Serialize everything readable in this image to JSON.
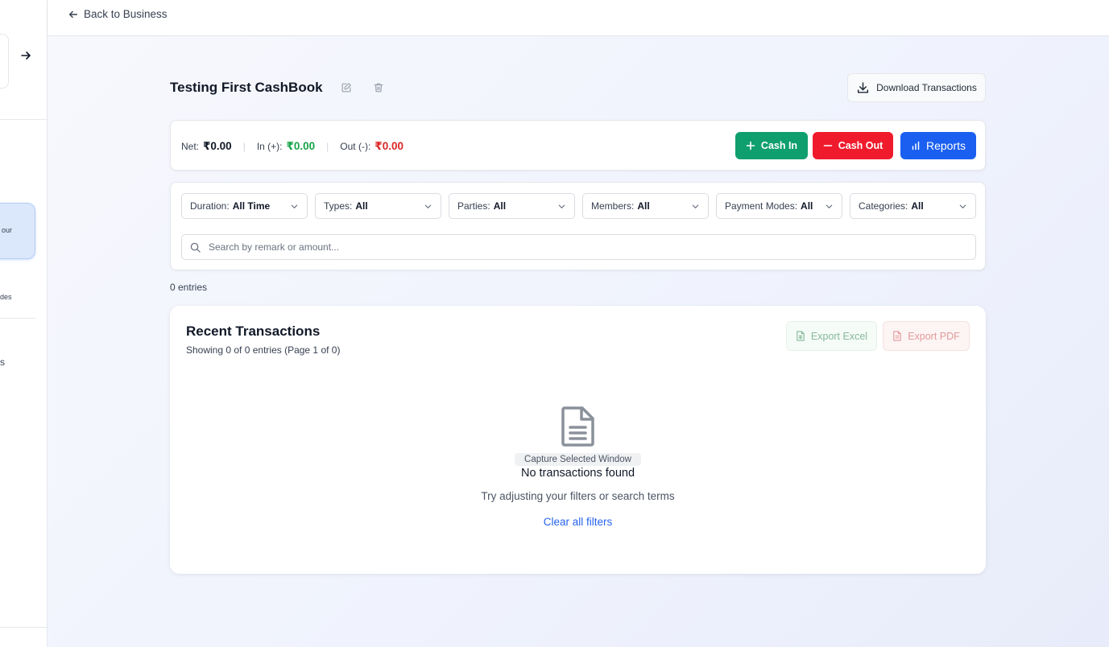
{
  "sidebar": {
    "active_item_label": "our",
    "item_label_2": "des",
    "item_label_3": "s"
  },
  "topbar": {
    "back_label": "Back to Business"
  },
  "header": {
    "title": "Testing First CashBook",
    "download_label": "Download Transactions"
  },
  "summary": {
    "net_label": "Net:",
    "net_value": "₹0.00",
    "in_label": "In (+):",
    "in_value": "₹0.00",
    "out_label": "Out (-):",
    "out_value": "₹0.00",
    "separator": "|",
    "cash_in_label": "Cash In",
    "cash_out_label": "Cash Out",
    "reports_label": "Reports",
    "colors": {
      "in": "#16a34a",
      "out": "#dc2626",
      "cash_in_bg": "#0f9f6e",
      "cash_out_bg": "#ef1b2d",
      "reports_bg": "#1a5ff0"
    }
  },
  "filters": [
    {
      "label": "Duration:",
      "value": "All Time"
    },
    {
      "label": "Types:",
      "value": "All"
    },
    {
      "label": "Parties:",
      "value": "All"
    },
    {
      "label": "Members:",
      "value": "All"
    },
    {
      "label": "Payment Modes:",
      "value": "All"
    },
    {
      "label": "Categories:",
      "value": "All"
    }
  ],
  "search": {
    "placeholder": "Search by remark or amount...",
    "value": ""
  },
  "entries_count": "0 entries",
  "transactions": {
    "title": "Recent Transactions",
    "subtitle": "Showing 0 of 0 entries (Page 1 of 0)",
    "export_excel_label": "Export Excel",
    "export_pdf_label": "Export PDF",
    "tooltip": "Capture Selected Window",
    "empty_title": "No transactions found",
    "empty_hint": "Try adjusting your filters or search terms",
    "clear_filters_label": "Clear all filters"
  }
}
